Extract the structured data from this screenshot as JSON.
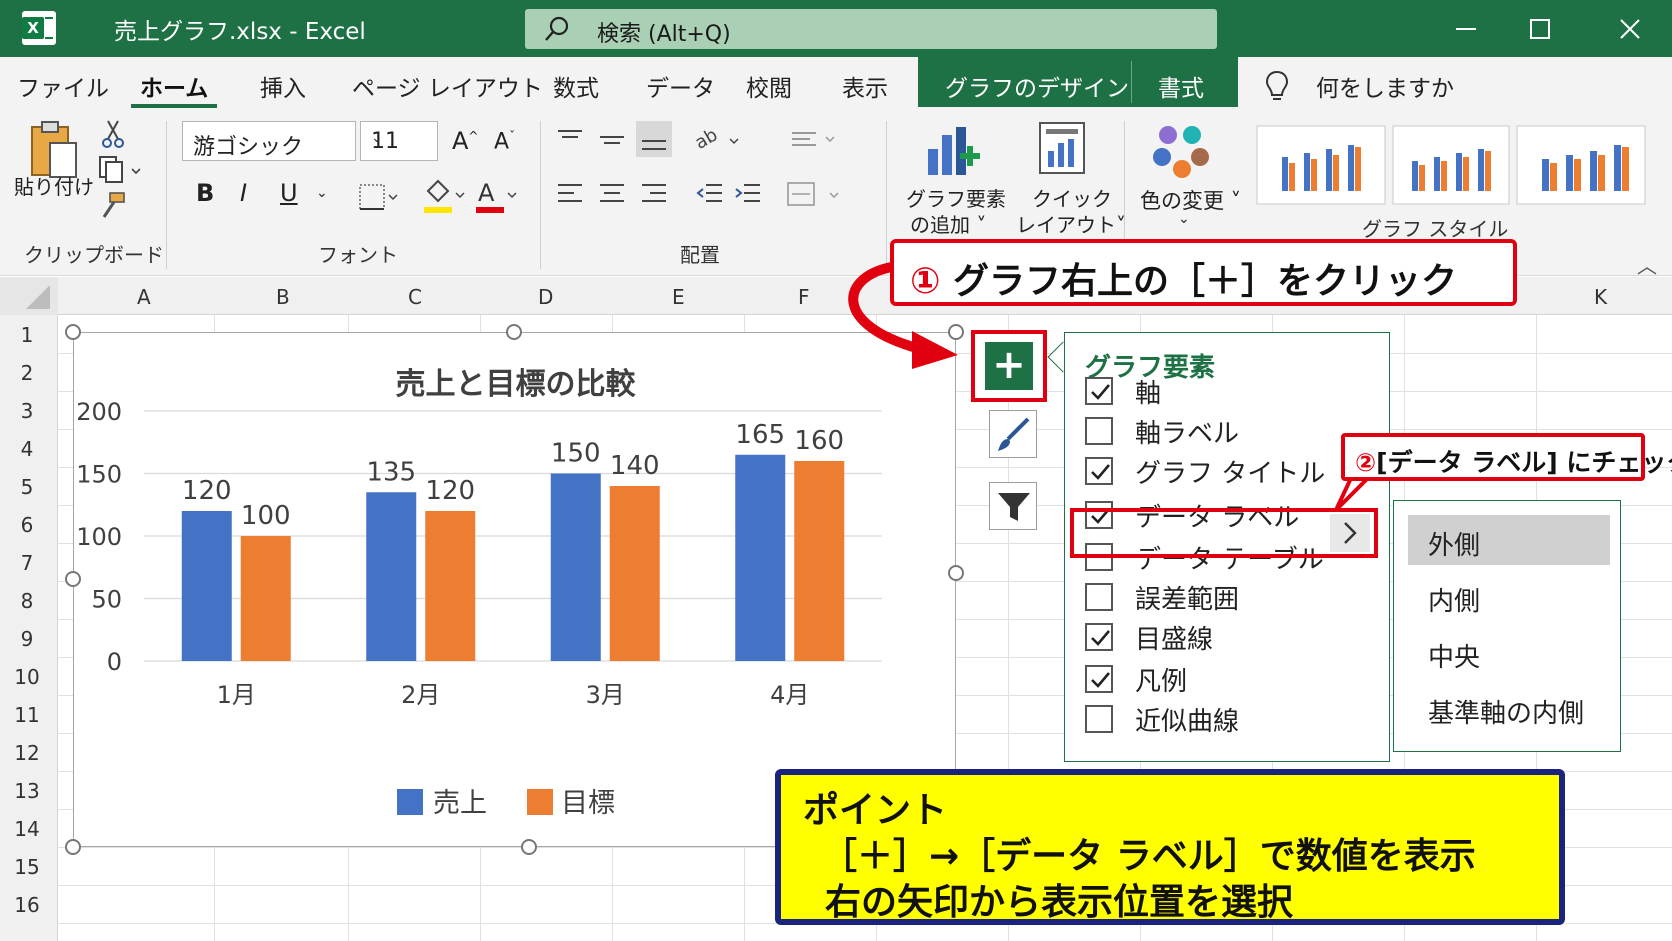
{
  "window": {
    "title": "売上グラフ.xlsx  -  Excel",
    "search_placeholder": "検索 (Alt+Q)",
    "app_color": "#1e7145"
  },
  "ribbon": {
    "tabs": [
      {
        "label": "ファイル"
      },
      {
        "label": "ホーム",
        "active": true
      },
      {
        "label": "挿入"
      },
      {
        "label": "ページ レイアウト"
      },
      {
        "label": "数式"
      },
      {
        "label": "データ"
      },
      {
        "label": "校閲"
      },
      {
        "label": "表示"
      }
    ],
    "context_tabs": [
      {
        "label": "グラフのデザイン"
      },
      {
        "label": "書式"
      }
    ],
    "tell_me": "何をしますか",
    "clipboard": {
      "paste_label": "貼り付け",
      "group_label": "クリップボード"
    },
    "font": {
      "name": "游ゴシック",
      "size": "11",
      "group_label": "フォント"
    },
    "alignment": {
      "group_label": "配置"
    },
    "chart_design": {
      "add_element_line1": "グラフ要素",
      "add_element_line2": "の追加 ˅",
      "quick_layout_line1": "クイック",
      "quick_layout_line2": "レイアウト˅",
      "change_colors": "色の変更 ˅",
      "styles_label": "グラフ スタイル"
    }
  },
  "sheet": {
    "columns": [
      "A",
      "B",
      "C",
      "D",
      "E",
      "F",
      "K"
    ],
    "rows": [
      "1",
      "2",
      "3",
      "4",
      "5",
      "6",
      "7",
      "8",
      "9",
      "10",
      "11",
      "12",
      "13",
      "14",
      "15",
      "16"
    ]
  },
  "chart_data": {
    "type": "bar",
    "title": "売上と目標の比較",
    "categories": [
      "1月",
      "2月",
      "3月",
      "4月"
    ],
    "series": [
      {
        "name": "売上",
        "values": [
          120,
          135,
          150,
          165
        ],
        "color": "#4472c4"
      },
      {
        "name": "目標",
        "values": [
          100,
          120,
          140,
          160
        ],
        "color": "#ed7d31"
      }
    ],
    "ylim": [
      0,
      200
    ],
    "yticks": [
      0,
      50,
      100,
      150,
      200
    ],
    "grid": true,
    "legend": "bottom",
    "data_labels": "outside"
  },
  "chart_elements_panel": {
    "title": "グラフ要素",
    "options": [
      {
        "label": "軸",
        "checked": true
      },
      {
        "label": "軸ラベル",
        "checked": false
      },
      {
        "label": "グラフ タイトル",
        "checked": true
      },
      {
        "label": "データ ラベル",
        "checked": true
      },
      {
        "label": "データ テーブル",
        "checked": false
      },
      {
        "label": "誤差範囲",
        "checked": false
      },
      {
        "label": "目盛線",
        "checked": true
      },
      {
        "label": "凡例",
        "checked": true
      },
      {
        "label": "近似曲線",
        "checked": false
      }
    ],
    "label_positions": [
      "外側",
      "内側",
      "中央",
      "基準軸の内側"
    ],
    "selected_position": "外側"
  },
  "annotations": {
    "step1_num": "①",
    "step1_text": "グラフ右上の［＋］をクリック",
    "step2_num": "②",
    "step2_text": "[データ ラベル] にチェック",
    "point_title": "ポイント",
    "point_line1": "［＋］→［データ ラベル］で数値を表示",
    "point_line2": "右の矢印から表示位置を選択",
    "highlight_color": "#e00010",
    "note_bg": "#ffff00"
  }
}
